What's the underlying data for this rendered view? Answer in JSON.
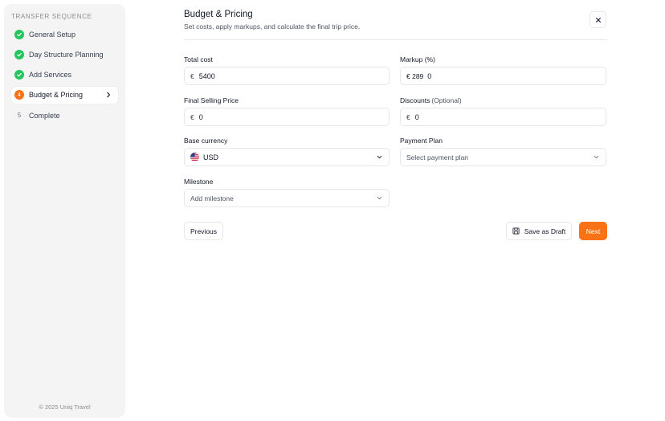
{
  "sidebar": {
    "title": "TRANSFER SEQUENCE",
    "steps": [
      {
        "label": "General Setup",
        "status": "done"
      },
      {
        "label": "Day Structure Planning",
        "status": "done"
      },
      {
        "label": "Add Services",
        "status": "done"
      },
      {
        "label": "Budget & Pricing",
        "status": "current",
        "number": "4"
      },
      {
        "label": "Complete",
        "status": "pending",
        "number": "5"
      }
    ],
    "footer": "© 2025 Uniq Travel"
  },
  "header": {
    "title": "Budget & Pricing",
    "subtitle": "Set costs, apply markups, and calculate the final trip price."
  },
  "form": {
    "total_cost": {
      "label": "Total cost",
      "prefix": "€",
      "value": "5400"
    },
    "markup": {
      "label": "Markup (%)",
      "prefix": "€ 289",
      "value": "0"
    },
    "final_price": {
      "label": "Final Selling Price",
      "prefix": "€",
      "value": "0"
    },
    "discounts": {
      "label": "Discounts",
      "optional": "(Optional)",
      "prefix": "€",
      "value": "0"
    },
    "base_currency": {
      "label": "Base currency",
      "value": "USD"
    },
    "payment_plan": {
      "label": "Payment Plan",
      "placeholder": "Select payment plan"
    },
    "milestone": {
      "label": "Milestone",
      "placeholder": "Add milestone"
    }
  },
  "actions": {
    "previous": "Previous",
    "save_draft": "Save as Draft",
    "next": "Next"
  },
  "colors": {
    "accent": "#f97316",
    "success": "#22c55e"
  }
}
